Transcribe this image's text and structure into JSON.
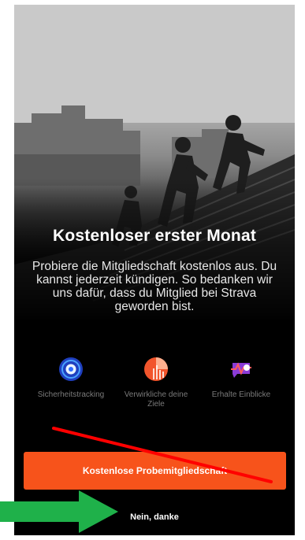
{
  "screen": {
    "title": "Kostenloser erster Monat",
    "description": "Probiere die Mitgliedschaft kostenlos aus. Du kannst jederzeit kündigen. So bedanken wir uns dafür, dass du Mitglied bei Strava geworden bist."
  },
  "features": [
    {
      "icon": "safety-tracking-icon",
      "label": "Sicherheitstracking",
      "color": "#2f6bff"
    },
    {
      "icon": "goals-icon",
      "label": "Verwirkliche deine Ziele",
      "color": "#f2552c"
    },
    {
      "icon": "insights-icon",
      "label": "Erhalte Einblicke",
      "color": "#8a3bd6"
    }
  ],
  "actions": {
    "primary_label": "Kostenlose Probemitgliedschaft",
    "secondary_label": "Nein, danke"
  },
  "colors": {
    "accent": "#f7531b",
    "annotation_arrow": "#1fb14a",
    "annotation_strike": "#ff0000"
  }
}
